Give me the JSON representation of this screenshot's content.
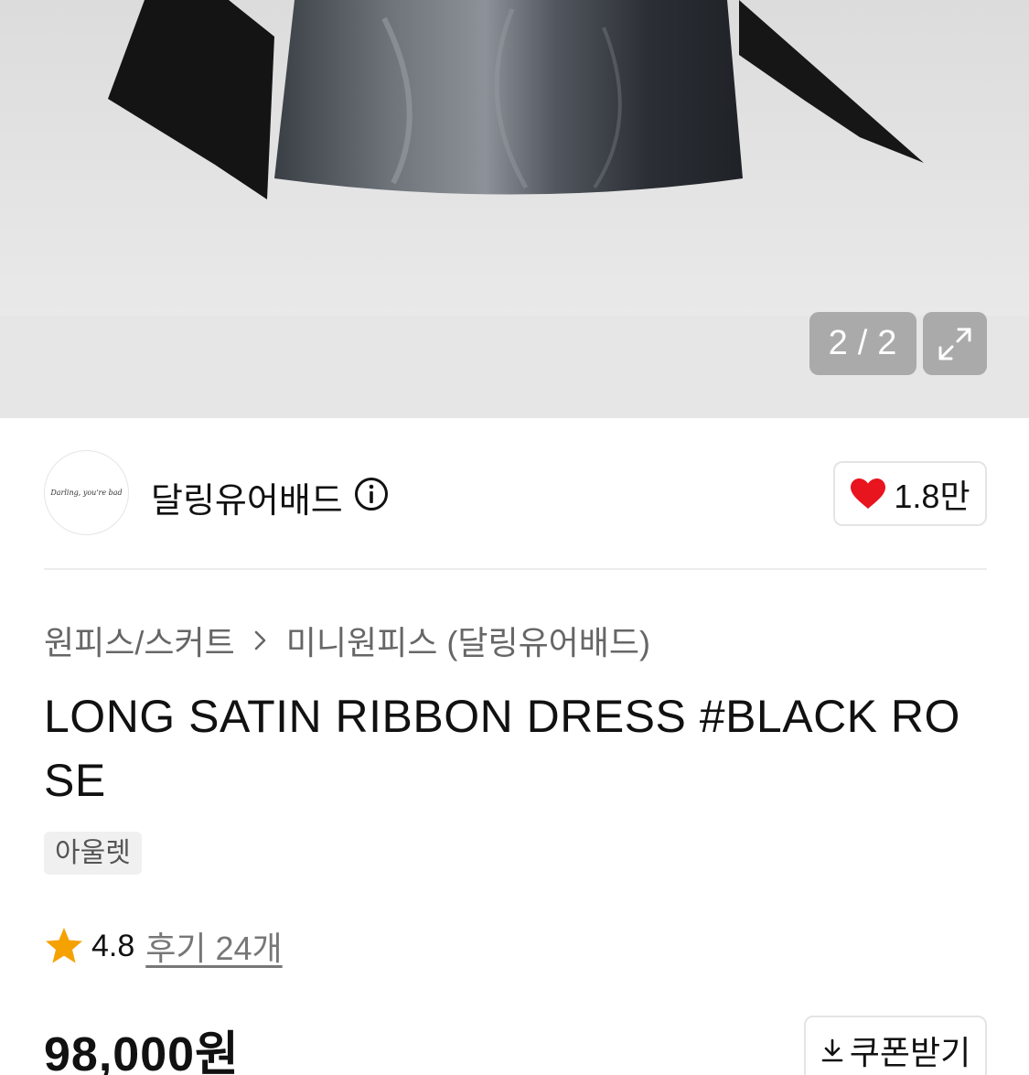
{
  "gallery": {
    "current": "2",
    "separator": "/",
    "total": "2"
  },
  "brand": {
    "logo_text": "Darling, you're bad",
    "name": "달링유어배드",
    "likes": "1.8만"
  },
  "breadcrumb": {
    "category": "원피스/스커트",
    "subcategory": "미니원피스 (달링유어배드)"
  },
  "product": {
    "title": "LONG SATIN RIBBON DRESS #BLACK ROSE",
    "tag": "아울렛",
    "rating": "4.8",
    "reviews_label": "후기 24개",
    "price": "98,000원",
    "coupon_label": "쿠폰받기"
  },
  "colors": {
    "heart": "#e8141e",
    "star": "#f5a100"
  }
}
